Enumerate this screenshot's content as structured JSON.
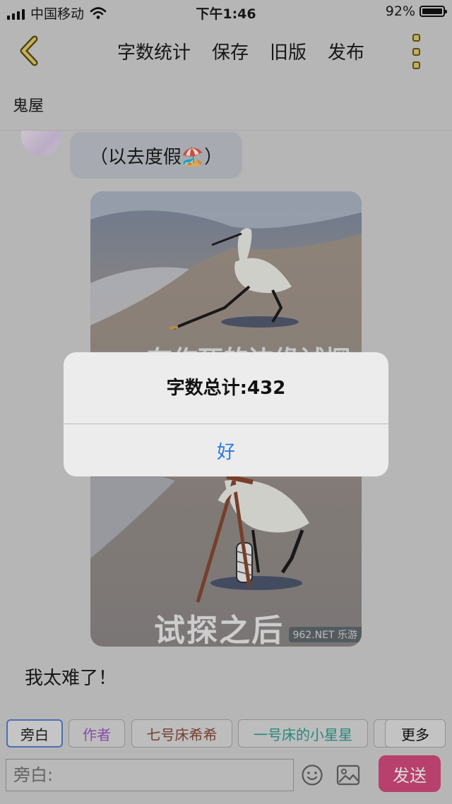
{
  "status_bar": {
    "carrier": "中国移动",
    "time": "下午1:46",
    "battery": "92%",
    "battery_level": 0.92
  },
  "nav": {
    "back_icon": "chevron-left-icon",
    "actions": [
      "字数统计",
      "保存",
      "旧版",
      "发布"
    ],
    "more_icon": "more-vertical-icon"
  },
  "chat": {
    "title": "鬼屋",
    "bubble_text": "（以去度假🏖️）",
    "image_caption_top": "在作死的边缘试探",
    "image_caption_bottom": "试探之后",
    "image_watermark": "962.NET 乐游",
    "text_message": "我太难了！"
  },
  "role_tags": [
    "旁白",
    "作者",
    "七号床希希",
    "一号床的小星星",
    "更多"
  ],
  "input": {
    "placeholder": "旁白:",
    "send_label": "发送",
    "emoji_icon": "emoji-icon",
    "image_icon": "image-icon"
  },
  "dialog": {
    "message": "字数总计:432",
    "ok_label": "好"
  },
  "colors": {
    "accent_send": "#d54c7e",
    "tag_author": "#9b59c4",
    "tag_bed7": "#8a4a3a",
    "tag_bed1": "#2f9e8f",
    "dialog_button": "#2a7ae2"
  }
}
